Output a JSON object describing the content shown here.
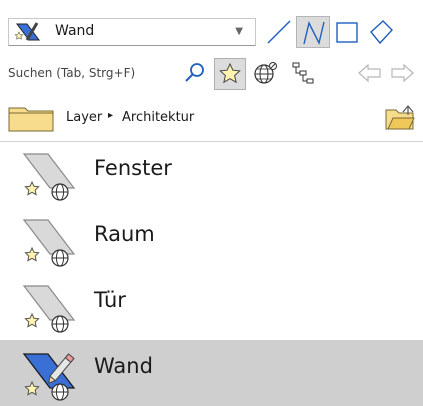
{
  "toolbar": {
    "feature_select": {
      "value": "Wand"
    },
    "draw_tools": [
      "line-tool",
      "polyline-tool",
      "rectangle-tool",
      "polygon-tool"
    ],
    "active_tool": "polyline-tool"
  },
  "search": {
    "placeholder": "Suchen (Tab, Strg+F)",
    "favorites_active": true
  },
  "breadcrumb": {
    "items": [
      "Layer",
      "Architektur"
    ],
    "separator": "▸"
  },
  "list": {
    "items": [
      {
        "label": "Fenster",
        "selected": false
      },
      {
        "label": "Raum",
        "selected": false
      },
      {
        "label": "Tür",
        "selected": false
      },
      {
        "label": "Wand",
        "selected": true
      }
    ]
  },
  "colors": {
    "selection_bg": "#cfcfcf",
    "active_tool_bg": "#dcdcdc",
    "feature_blue": "#3a6fd6",
    "star_fill": "#fff3b0",
    "folder_fill": "#f6dc8c"
  }
}
